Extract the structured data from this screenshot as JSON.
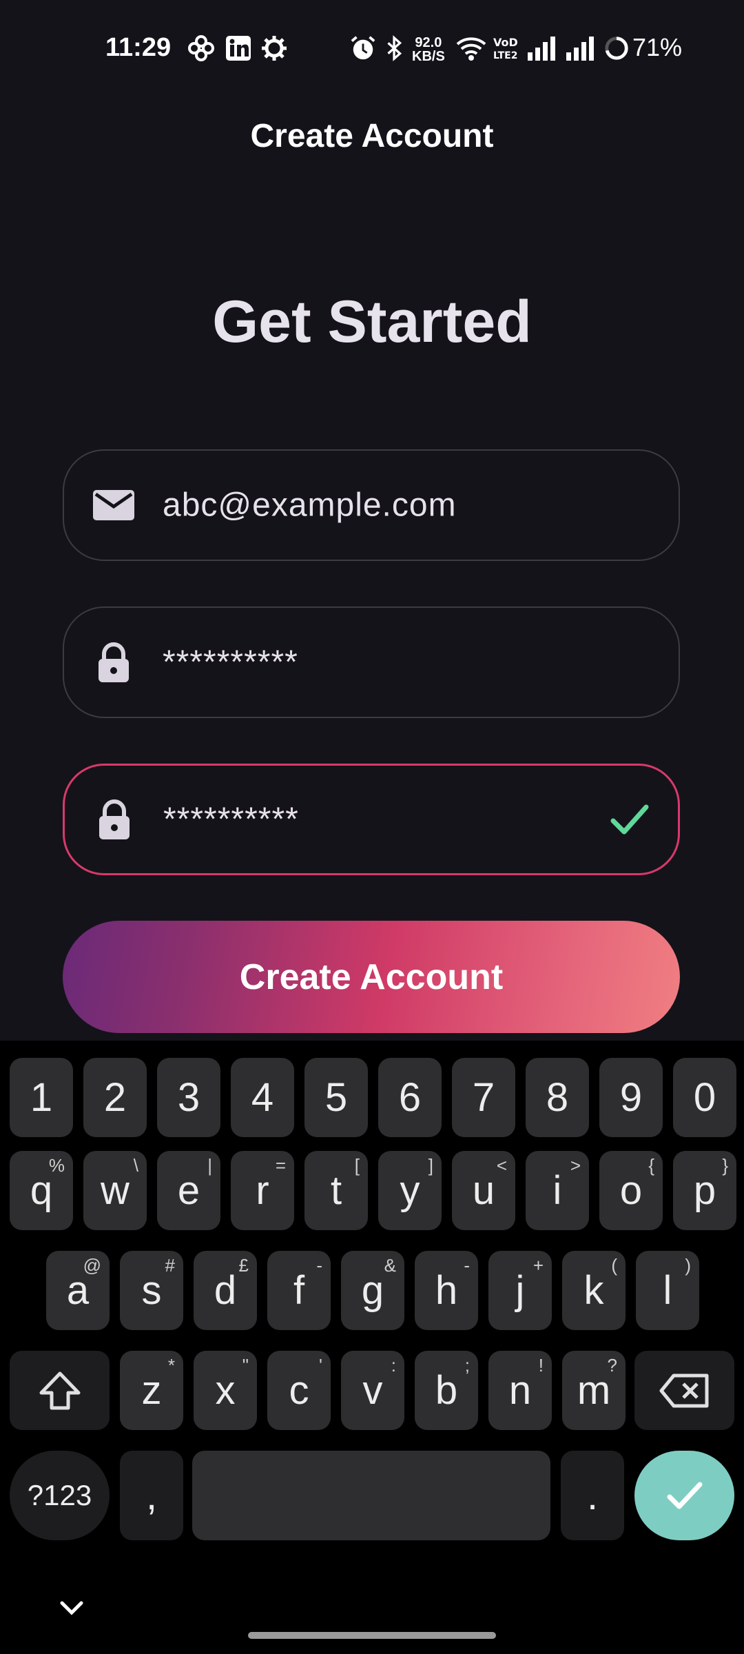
{
  "status_bar": {
    "time": "11:29",
    "net_speed_value": "92.0",
    "net_speed_unit": "KB/S",
    "battery": "71%",
    "icons": [
      "pinwheel-icon",
      "linkedin-icon",
      "gear-icon",
      "alarm-icon",
      "bluetooth-icon",
      "wifi-icon",
      "volte-icon",
      "signal-icon",
      "signal-icon",
      "battery-ring-icon"
    ]
  },
  "app_bar": {
    "title": "Create Account"
  },
  "headline": "Get Started",
  "form": {
    "email": {
      "value": "abc@example.com",
      "icon": "mail-icon"
    },
    "password": {
      "value": "**********",
      "icon": "lock-icon"
    },
    "confirm_password": {
      "value": "**********",
      "icon": "lock-icon",
      "valid_icon": "checkmark-icon"
    }
  },
  "cta_label": "Create Account",
  "colors": {
    "background": "#15131a",
    "active_border": "#d83a6a",
    "gradient_start": "#6a2a78",
    "gradient_end": "#f07f82",
    "check": "#5fd89a",
    "enter_key": "#7ecdc2"
  },
  "keyboard": {
    "numbers": [
      "1",
      "2",
      "3",
      "4",
      "5",
      "6",
      "7",
      "8",
      "9",
      "0"
    ],
    "row1": [
      {
        "k": "q",
        "h": "%"
      },
      {
        "k": "w",
        "h": "\\"
      },
      {
        "k": "e",
        "h": "|"
      },
      {
        "k": "r",
        "h": "="
      },
      {
        "k": "t",
        "h": "["
      },
      {
        "k": "y",
        "h": "]"
      },
      {
        "k": "u",
        "h": "<"
      },
      {
        "k": "i",
        "h": ">"
      },
      {
        "k": "o",
        "h": "{"
      },
      {
        "k": "p",
        "h": "}"
      }
    ],
    "row2": [
      {
        "k": "a",
        "h": "@"
      },
      {
        "k": "s",
        "h": "#"
      },
      {
        "k": "d",
        "h": "£"
      },
      {
        "k": "f",
        "h": "-"
      },
      {
        "k": "g",
        "h": "&"
      },
      {
        "k": "h",
        "h": "-"
      },
      {
        "k": "j",
        "h": "+"
      },
      {
        "k": "k",
        "h": "("
      },
      {
        "k": "l",
        "h": ")"
      }
    ],
    "row3": [
      {
        "k": "z",
        "h": "*"
      },
      {
        "k": "x",
        "h": "\""
      },
      {
        "k": "c",
        "h": "'"
      },
      {
        "k": "v",
        "h": ":"
      },
      {
        "k": "b",
        "h": ";"
      },
      {
        "k": "n",
        "h": "!"
      },
      {
        "k": "m",
        "h": "?"
      }
    ],
    "symbols_key": "?123",
    "comma": ",",
    "period": "."
  }
}
